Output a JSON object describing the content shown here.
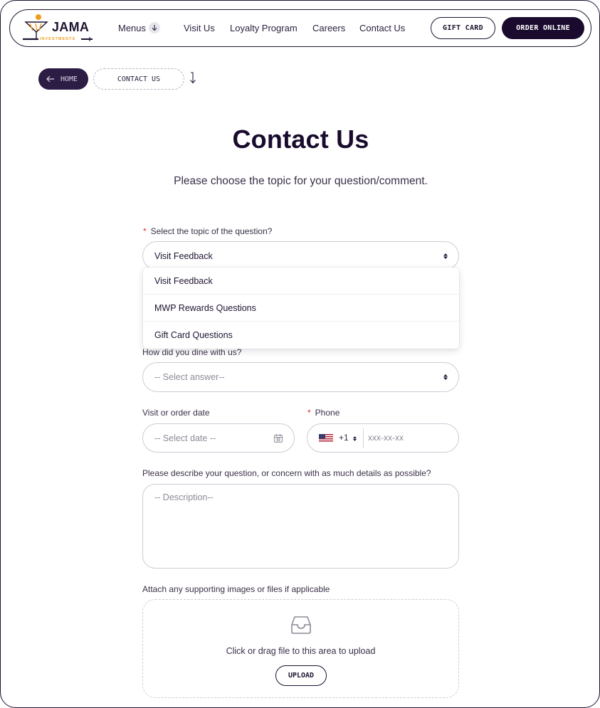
{
  "brand": {
    "name": "JAMA",
    "tagline": "INVESTMENTS",
    "accent": "#f29b1d",
    "dark": "#1a0b2e"
  },
  "nav": {
    "links": [
      "Menus",
      "Visit Us",
      "Loyalty Program",
      "Careers",
      "Contact Us"
    ],
    "gift_card": "GIFT CARD",
    "order_online": "ORDER ONLINE"
  },
  "breadcrumb": {
    "home": "HOME",
    "current": "CONTACT US"
  },
  "page": {
    "title": "Contact Us",
    "subtitle": "Please choose the topic for your question/comment."
  },
  "form": {
    "topic": {
      "label": "Select the topic of the question?",
      "value": "Visit Feedback",
      "options": [
        "Visit Feedback",
        "MWP Rewards Questions",
        "Gift Card Questions"
      ]
    },
    "dine": {
      "label": "How did you dine with us?",
      "placeholder": "-- Select answer--"
    },
    "date": {
      "label": "Visit or order date",
      "placeholder": "-- Select date --"
    },
    "phone": {
      "label": "Phone",
      "code": "+1",
      "placeholder": "xxx-xx-xx"
    },
    "description": {
      "label": "Please describe your question, or concern with as much details as possible?",
      "placeholder": "-- Description--"
    },
    "attach": {
      "label": "Attach any supporting images or files if applicable",
      "hint": "Click or drag file to this area to upload",
      "button": "UPLOAD"
    }
  }
}
